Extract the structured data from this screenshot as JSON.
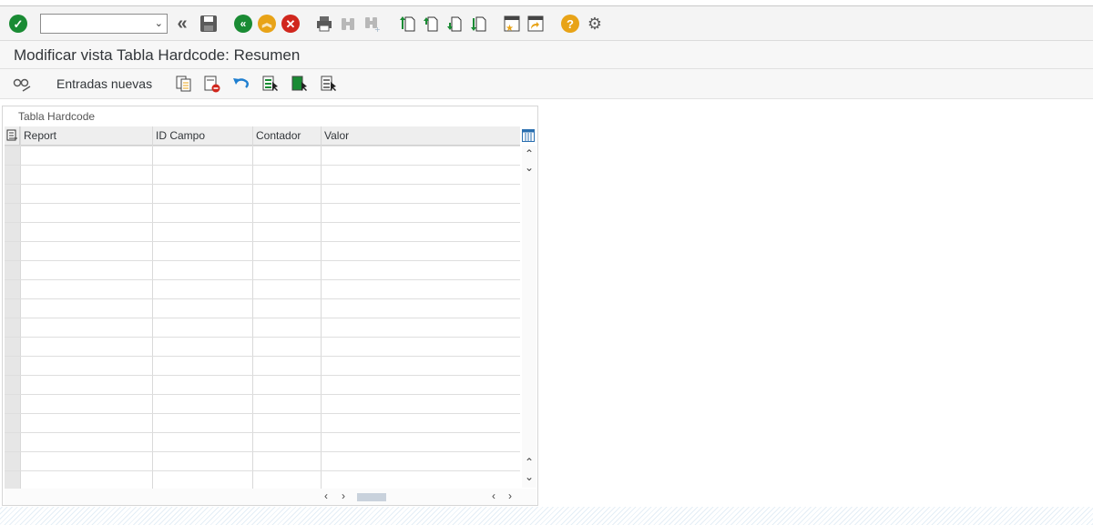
{
  "window": {
    "title": "Modificar vista Tabla Hardcode: Resumen"
  },
  "toolbar": {
    "command_field_value": "",
    "icons": [
      "check-icon",
      "back-double-icon",
      "save-icon",
      "back-icon",
      "exit-icon",
      "cancel-icon",
      "print-icon",
      "find-icon",
      "find-next-icon",
      "first-page-icon",
      "previous-page-icon",
      "next-page-icon",
      "last-page-icon",
      "new-session-icon",
      "shortcut-icon",
      "help-icon",
      "settings-icon"
    ],
    "colors": {
      "green": "#1a8b34",
      "orange": "#e8a317",
      "red": "#d0271d",
      "help": "#e8a317"
    }
  },
  "app_toolbar": {
    "new_entries_label": "Entradas nuevas"
  },
  "table": {
    "title": "Tabla Hardcode",
    "columns": [
      "Report",
      "ID Campo",
      "Contador",
      "Valor"
    ],
    "row_count": 18
  }
}
